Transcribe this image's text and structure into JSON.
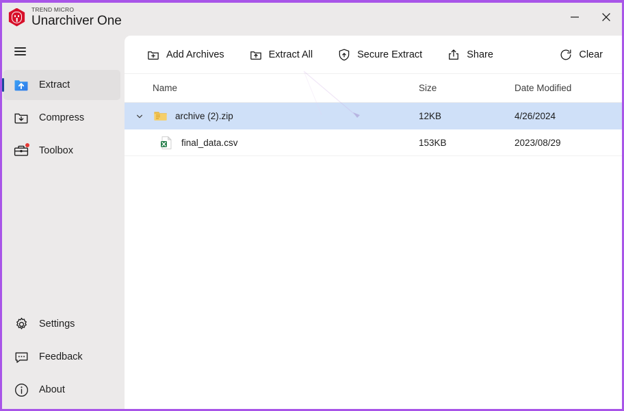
{
  "window": {
    "brand_sup": "TREND MICRO",
    "brand_name": "Unarchiver One",
    "controls": [
      {
        "name": "minimize",
        "glyph": "minimize-icon"
      },
      {
        "name": "close",
        "glyph": "close-icon"
      }
    ],
    "border_color": "#a855e8",
    "chrome_bg": "#eceaea"
  },
  "sidebar": {
    "menu_button": "hamburger-icon",
    "items": [
      {
        "label": "Extract",
        "icon": "folder-up-filled-icon",
        "active": true,
        "badge": false
      },
      {
        "label": "Compress",
        "icon": "folder-down-icon",
        "active": false,
        "badge": false
      },
      {
        "label": "Toolbox",
        "icon": "toolbox-icon",
        "active": false,
        "badge": true
      }
    ],
    "bottom_items": [
      {
        "label": "Settings",
        "icon": "gear-icon"
      },
      {
        "label": "Feedback",
        "icon": "chat-dots-icon"
      },
      {
        "label": "About",
        "icon": "info-circle-icon"
      }
    ],
    "active_indicator_color": "#1b4a9c"
  },
  "toolbar": {
    "buttons": [
      {
        "label": "Add Archives",
        "icon": "folder-plus-icon"
      },
      {
        "label": "Extract All",
        "icon": "folder-arrow-up-icon"
      },
      {
        "label": "Secure Extract",
        "icon": "shield-arrow-up-icon"
      },
      {
        "label": "Share",
        "icon": "share-box-up-icon"
      }
    ],
    "clear": {
      "label": "Clear",
      "icon": "reset-circle-icon"
    }
  },
  "file_list": {
    "columns": [
      {
        "key": "name",
        "label": "Name"
      },
      {
        "key": "size",
        "label": "Size"
      },
      {
        "key": "date",
        "label": "Date Modified"
      }
    ],
    "selection_color": "#cfe0f8",
    "rows": [
      {
        "name": "archive (2).zip",
        "size": "12KB",
        "date": "4/26/2024",
        "icon": "zip-folder-icon",
        "expander": "chevron-down-icon",
        "selected": true,
        "child": false
      },
      {
        "name": "final_data.csv",
        "size": "153KB",
        "date": "2023/08/29",
        "icon": "csv-file-icon",
        "expander": "",
        "selected": false,
        "child": true
      }
    ]
  }
}
